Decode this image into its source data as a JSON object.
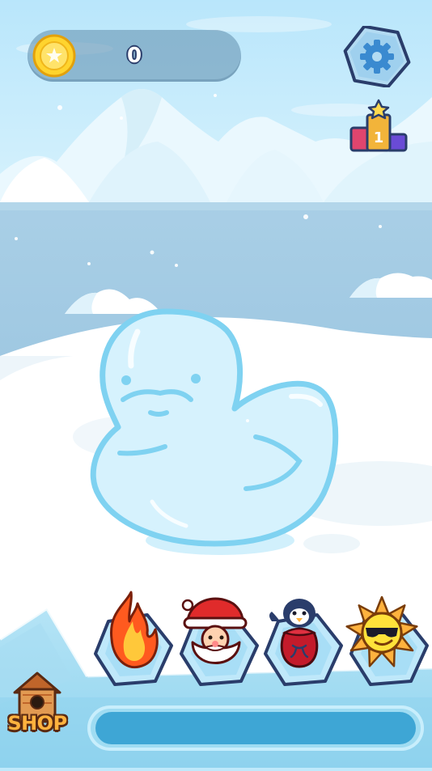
{
  "hud": {
    "coins": "0",
    "settings_icon": "gear-icon",
    "leaderboard_icon": "podium-trophy-icon",
    "leaderboard_rank": "1"
  },
  "sculpture": {
    "shape": "ice-duck",
    "progress_fraction": 0
  },
  "tray": {
    "items": [
      {
        "name": "fire",
        "icon": "fire-icon"
      },
      {
        "name": "santa",
        "icon": "santa-icon"
      },
      {
        "name": "penguin",
        "icon": "penguin-icon"
      },
      {
        "name": "sun",
        "icon": "sun-icon"
      }
    ],
    "shop_label": "SHOP"
  },
  "colors": {
    "sky": "#bfe9fb",
    "ice_blue": "#7fd2f1",
    "coin_gold": "#ffd42e",
    "shop_orange": "#ffb23e"
  }
}
